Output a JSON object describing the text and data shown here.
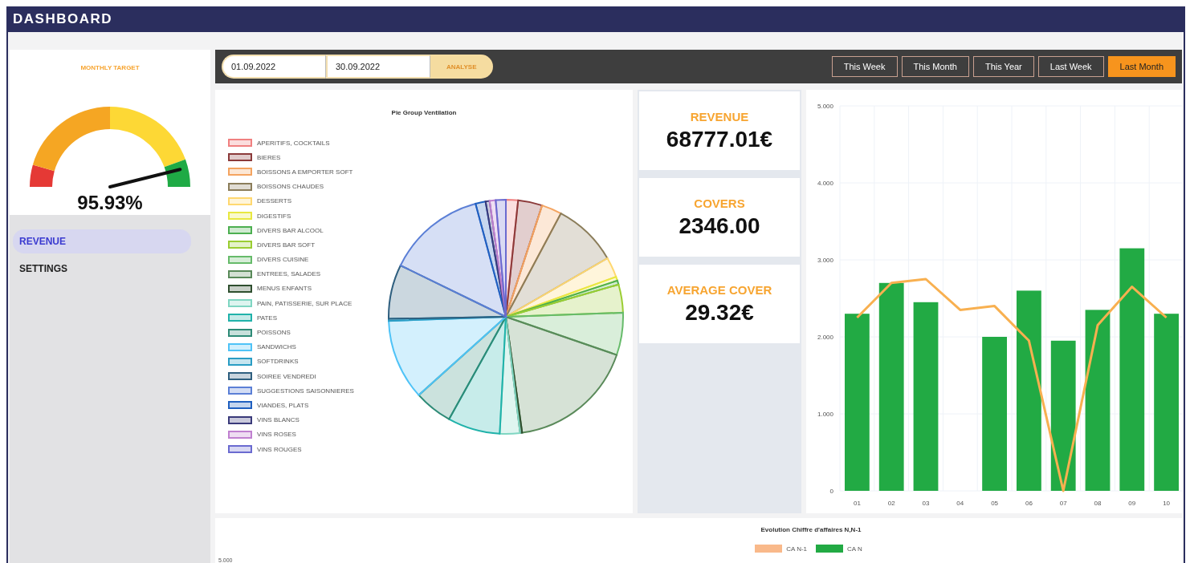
{
  "header": {
    "title": "DASHBOARD"
  },
  "gauge": {
    "title": "MONTHLY TARGET",
    "value": "95.93%"
  },
  "nav": [
    {
      "label": "REVENUE",
      "selected": true
    },
    {
      "label": "SETTINGS",
      "selected": false
    }
  ],
  "toolbar": {
    "date_from": "01.09.2022",
    "date_to": "30.09.2022",
    "analyse_button": "ANALYSE",
    "periods": [
      {
        "label": "This Week",
        "selected": false
      },
      {
        "label": "This Month",
        "selected": false
      },
      {
        "label": "This Year",
        "selected": false
      },
      {
        "label": "Last Week",
        "selected": false
      },
      {
        "label": "Last Month",
        "selected": true
      }
    ]
  },
  "pie_card": {
    "title": "Pie Group Ventilation",
    "legend": [
      {
        "label": "APERITIFS, COCKTAILS",
        "color": "#f08080"
      },
      {
        "label": "BIERES",
        "color": "#8b3a3a"
      },
      {
        "label": "BOISSONS A EMPORTER SOFT",
        "color": "#f4a460"
      },
      {
        "label": "BOISSONS CHAUDES",
        "color": "#8b7d5a"
      },
      {
        "label": "DESSERTS",
        "color": "#ffd870"
      },
      {
        "label": "DIGESTIFS",
        "color": "#e8e840"
      },
      {
        "label": "DIVERS BAR ALCOOL",
        "color": "#4caf50"
      },
      {
        "label": "DIVERS BAR SOFT",
        "color": "#9acd32"
      },
      {
        "label": "DIVERS CUISINE",
        "color": "#66bb6a"
      },
      {
        "label": "ENTREES, SALADES",
        "color": "#5a8a5a"
      },
      {
        "label": "MENUS ENFANTS",
        "color": "#2f4f2f"
      },
      {
        "label": "PAIN, PATISSERIE, SUR PLACE",
        "color": "#7fd6c2"
      },
      {
        "label": "PATES",
        "color": "#20b2aa"
      },
      {
        "label": "POISSONS",
        "color": "#2e8b77"
      },
      {
        "label": "SANDWICHS",
        "color": "#4fc3f7"
      },
      {
        "label": "SOFTDRINKS",
        "color": "#2a9dc4"
      },
      {
        "label": "SOIREE VENDREDI",
        "color": "#2f5f7f"
      },
      {
        "label": "SUGGESTIONS SAISONNIERES",
        "color": "#5b7fd6"
      },
      {
        "label": "VIANDES, PLATS",
        "color": "#2060c0"
      },
      {
        "label": "VINS BLANCS",
        "color": "#3a3a7a"
      },
      {
        "label": "VINS ROSES",
        "color": "#c080d0"
      },
      {
        "label": "VINS ROUGES",
        "color": "#6a6ad0"
      }
    ]
  },
  "kpis": [
    {
      "label": "REVENUE",
      "value": "68777.01€"
    },
    {
      "label": "COVERS",
      "value": "2346.00"
    },
    {
      "label": "AVERAGE COVER",
      "value": "29.32€"
    }
  ],
  "daily_chart": {
    "chart_data": {
      "type": "bar",
      "grid": true,
      "categories": [
        "01",
        "02",
        "03",
        "04",
        "05",
        "06",
        "07",
        "08",
        "09",
        "10"
      ],
      "ylim": [
        0,
        5
      ],
      "yticks": [
        {
          "value": 0,
          "label": "0"
        },
        {
          "value": 1,
          "label": "1.000"
        },
        {
          "value": 2,
          "label": "2.000"
        },
        {
          "value": 3,
          "label": "3.000"
        },
        {
          "value": 4,
          "label": "4.000"
        },
        {
          "value": 5,
          "label": "5.000"
        }
      ],
      "series": [
        {
          "color": "#22aa44",
          "values": [
            2.3,
            2.7,
            2.45,
            null,
            2.0,
            2.6,
            1.95,
            2.35,
            3.15,
            2.3
          ]
        },
        {
          "type": "line",
          "color": "#f8b050",
          "values": [
            2.25,
            2.7,
            2.75,
            2.35,
            2.4,
            1.95,
            0,
            2.15,
            2.65,
            2.25
          ]
        }
      ]
    }
  },
  "evolution_card": {
    "title": "Evolution Chiffre d'affaires N,N-1",
    "legend": [
      {
        "label": "CA N-1",
        "color": "#f9b98a"
      },
      {
        "label": "CA N",
        "color": "#22aa44"
      }
    ],
    "tick": "5.000"
  }
}
